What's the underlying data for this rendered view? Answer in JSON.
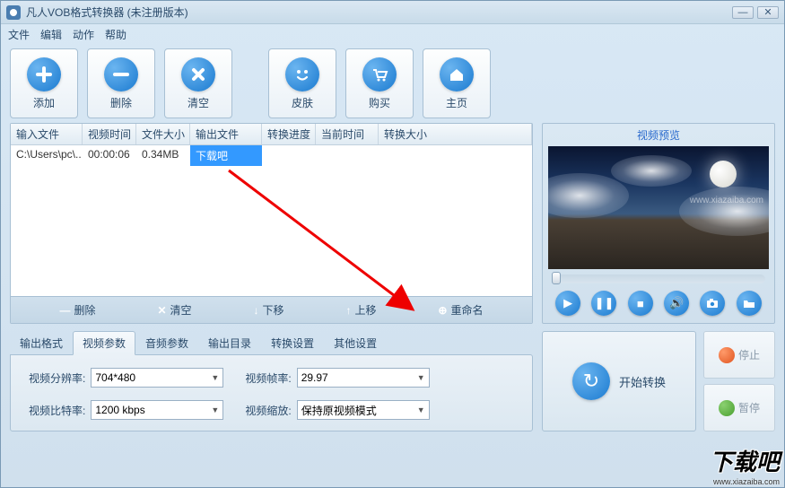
{
  "window": {
    "title": "凡人VOB格式转换器  (未注册版本)"
  },
  "menu": {
    "file": "文件",
    "edit": "编辑",
    "action": "动作",
    "help": "帮助"
  },
  "toolbar": {
    "add": "添加",
    "delete": "删除",
    "clear": "清空",
    "skin": "皮肤",
    "buy": "购买",
    "home": "主页"
  },
  "table": {
    "headers": {
      "input": "输入文件",
      "vtime": "视频时间",
      "fsize": "文件大小",
      "output": "输出文件",
      "progress": "转换进度",
      "curtime": "当前时间",
      "cvsize": "转换大小"
    },
    "rows": [
      {
        "input": "C:\\Users\\pc\\...",
        "vtime": "00:00:06",
        "fsize": "0.34MB",
        "output": "下载吧",
        "progress": "",
        "curtime": "",
        "cvsize": ""
      }
    ]
  },
  "list_actions": {
    "delete": "删除",
    "clear": "清空",
    "movedown": "下移",
    "moveup": "上移",
    "rename": "重命名"
  },
  "preview": {
    "title": "视频预览",
    "watermark": "www.xiazaiba.com"
  },
  "tabs": {
    "format": "输出格式",
    "video": "视频参数",
    "audio": "音频参数",
    "outdir": "输出目录",
    "convset": "转换设置",
    "other": "其他设置"
  },
  "video_params": {
    "res_label": "视频分辨率:",
    "res_value": "704*480",
    "fps_label": "视频帧率:",
    "fps_value": "29.97",
    "bitrate_label": "视频比特率:",
    "bitrate_value": "1200 kbps",
    "scale_label": "视频缩放:",
    "scale_value": "保持原视频模式"
  },
  "convert": {
    "start": "开始转换",
    "stop": "停止",
    "pause": "暂停"
  },
  "watermark": {
    "text": "下载吧",
    "url": "www.xiazaiba.com"
  }
}
